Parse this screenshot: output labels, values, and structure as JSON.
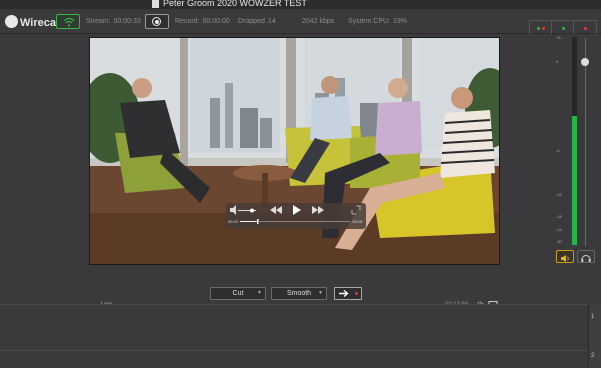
{
  "window": {
    "title": "Peter Groom 2020 WOWZER TEST"
  },
  "app": {
    "name": "Wirecast"
  },
  "toolbar": {
    "stream_label": "Stream:",
    "stream_time": "00:00:33",
    "record_label": "Record:",
    "record_time": "00:00:00",
    "dropped_label": "Dropped",
    "dropped_count": "14",
    "bitrate": "2042 kbps",
    "cpu_label": "System CPU:",
    "cpu_value": "19%"
  },
  "preview": {
    "live_label": "Live",
    "timecode": "00:13:56",
    "player_elapsed": "00:22",
    "player_remaining": "-53:18"
  },
  "audio": {
    "scale": [
      "+6",
      "0",
      "-6",
      "-12",
      "-18",
      "-24",
      "-30"
    ],
    "level_fraction": 0.62
  },
  "controls": {
    "transition_1": "Cut",
    "transition_2": "Smooth"
  },
  "rows": {
    "row1": "1",
    "row2": "2"
  },
  "colors": {
    "accent_green": "#3bb34a",
    "live_red": "#e23b3b",
    "audio_gold": "#c89b1c"
  },
  "icons": [
    "document-icon",
    "wirecast-logo-icon",
    "wifi-icon",
    "record-icon",
    "gear-icon",
    "monitor-icon",
    "speaker-icon",
    "headphones-icon",
    "arrow-right-icon",
    "rewind-icon",
    "play-icon",
    "fast-forward-icon",
    "volume-icon",
    "expand-icon"
  ]
}
